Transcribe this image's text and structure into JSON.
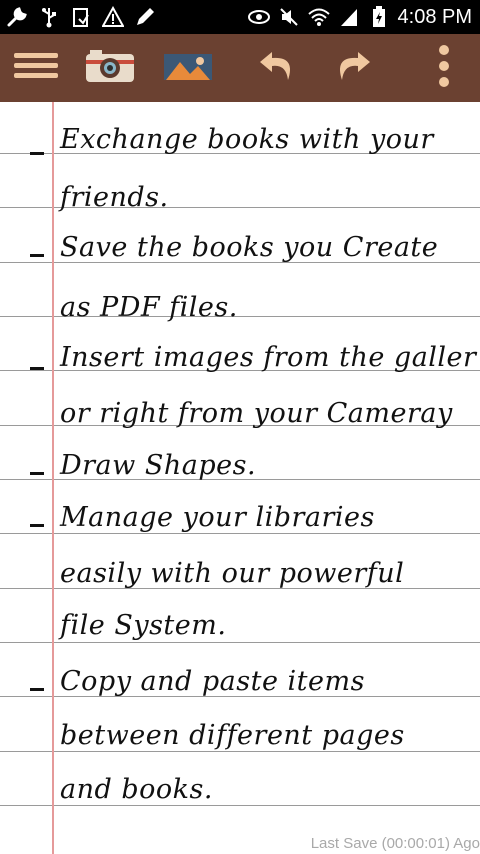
{
  "status_bar": {
    "time": "4:08 PM",
    "left_icons": [
      "wrench-icon",
      "usb-icon",
      "clipboard-icon",
      "warning-icon",
      "pencil-icon"
    ],
    "right_icons": [
      "eye-icon",
      "mute-icon",
      "wifi-icon",
      "signal-icon",
      "battery-icon"
    ]
  },
  "toolbar": {
    "buttons": [
      "menu-icon",
      "camera-icon",
      "gallery-icon",
      "undo-icon",
      "redo-icon",
      "overflow-icon"
    ]
  },
  "note": {
    "lines": [
      "Exchange books with your",
      "friends.",
      "Save the books you Create",
      "as PDF files.",
      "Insert images from the galler",
      "or right from your Cameray",
      "Draw Shapes.",
      "Manage your libraries",
      "easily with our powerful",
      "file System.",
      "Copy and paste items",
      "between different pages",
      "and books."
    ]
  },
  "footer": {
    "last_save": "Last Save (00:00:01) Ago"
  },
  "colors": {
    "toolbar": "#6b4131",
    "margin": "#e59a9a",
    "rule": "#9a9a9a"
  }
}
